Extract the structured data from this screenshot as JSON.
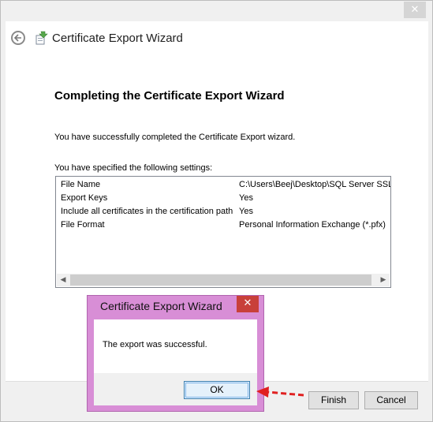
{
  "window": {
    "close_glyph": "✕"
  },
  "header": {
    "title": "Certificate Export Wizard"
  },
  "content": {
    "heading": "Completing the Certificate Export Wizard",
    "completed_text": "You have successfully completed the Certificate Export wizard.",
    "settings_intro": "You have specified the following settings:",
    "settings": [
      {
        "key": "File Name",
        "value": "C:\\Users\\Beej\\Desktop\\SQL Server SSL"
      },
      {
        "key": "Export Keys",
        "value": "Yes"
      },
      {
        "key": "Include all certificates in the certification path",
        "value": "Yes"
      },
      {
        "key": "File Format",
        "value": "Personal Information Exchange (*.pfx)"
      }
    ]
  },
  "footer": {
    "finish_label": "Finish",
    "cancel_label": "Cancel"
  },
  "dialog": {
    "title": "Certificate Export Wizard",
    "message": "The export was successful.",
    "ok_label": "OK",
    "close_glyph": "✕"
  },
  "colors": {
    "dialog_frame": "#d88ed6",
    "dialog_close": "#c8403a",
    "annotation_arrow": "#e02020"
  },
  "icons": {
    "back": "back-arrow-icon",
    "wizard": "certificate-icon",
    "annotation": "red-dashed-arrow"
  }
}
